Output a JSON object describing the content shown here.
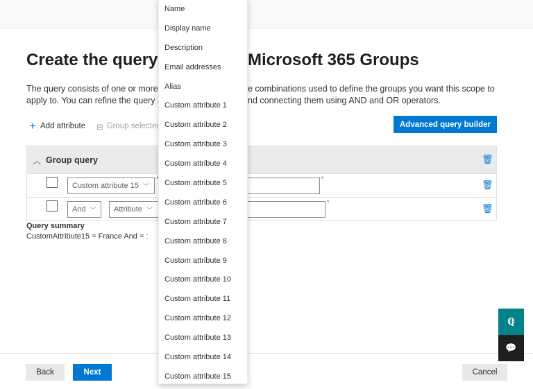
{
  "title": {
    "left": "Create the query",
    "right": "Microsoft 365 Groups"
  },
  "description": {
    "line1_left": "The query consists of one or more",
    "line1_right": "e combinations used to define the groups you want this scope to",
    "line2_left": "apply to. You can refine the query b",
    "line2_right": "nd connecting them using AND and OR operators."
  },
  "toolbar": {
    "add_attribute": "Add attribute",
    "group_selected": "Group selected",
    "advanced": "Advanced query builder"
  },
  "group_query": {
    "title": "Group query",
    "rows": [
      {
        "attribute": "Custom attribute 15",
        "value_fragment": "e"
      },
      {
        "operator": "And",
        "attribute": "Attribute",
        "value_fragment": "e"
      }
    ]
  },
  "summary": {
    "label": "Query summary",
    "text": "CustomAttribute15 = France And = :"
  },
  "dropdown": {
    "items": [
      "Name",
      "Display name",
      "Description",
      "Email addresses",
      "Alias",
      "Custom attribute 1",
      "Custom attribute 2",
      "Custom attribute 3",
      "Custom attribute 4",
      "Custom attribute 5",
      "Custom attribute 6",
      "Custom attribute 7",
      "Custom attribute 8",
      "Custom attribute 9",
      "Custom attribute 10",
      "Custom attribute 11",
      "Custom attribute 12",
      "Custom attribute 13",
      "Custom attribute 14",
      "Custom attribute 15"
    ]
  },
  "footer": {
    "back": "Back",
    "next": "Next",
    "cancel": "Cancel"
  },
  "colors": {
    "accent": "#0078d4",
    "help": "#038387",
    "feedback": "#201f1e"
  }
}
